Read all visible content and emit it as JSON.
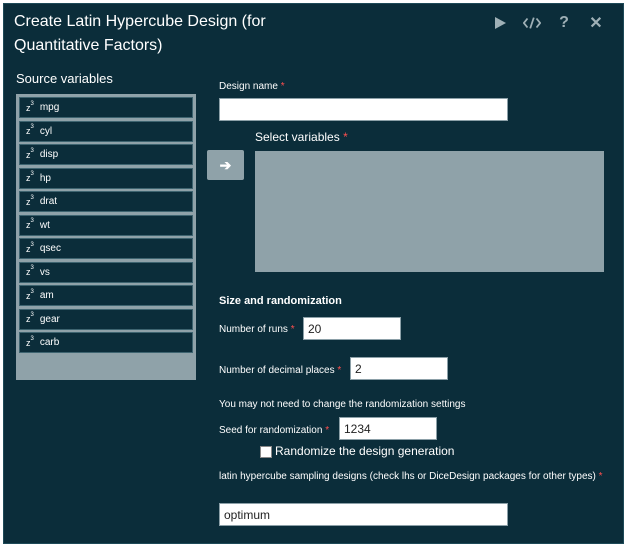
{
  "window": {
    "title": "Create Latin Hypercube Design (for Quantitative Factors)",
    "icons": [
      "run-icon",
      "code-icon",
      "help-icon",
      "close-icon"
    ]
  },
  "source": {
    "label": "Source variables",
    "items": [
      {
        "icon_text": "z",
        "label": "mpg"
      },
      {
        "icon_text": "z",
        "label": "cyl"
      },
      {
        "icon_text": "z",
        "label": "disp"
      },
      {
        "icon_text": "z",
        "label": "hp"
      },
      {
        "icon_text": "z",
        "label": "drat"
      },
      {
        "icon_text": "z",
        "label": "wt"
      },
      {
        "icon_text": "z",
        "label": "qsec"
      },
      {
        "icon_text": "z",
        "label": "vs"
      },
      {
        "icon_text": "z",
        "label": "am"
      },
      {
        "icon_text": "z",
        "label": "gear"
      },
      {
        "icon_text": "z",
        "label": "carb"
      }
    ]
  },
  "form": {
    "design_name_label": "Design name",
    "design_name_value": "",
    "select_variables_label": "Select variables",
    "arrow_glyph": "➔",
    "size_section": "Size and randomization",
    "runs_label": "Number of runs",
    "runs_value": "20",
    "decimals_label": "Number of decimal places",
    "decimals_value": "2",
    "randomization_note": "You may not need to change the randomization settings",
    "seed_label": "Seed for randomization",
    "seed_value": "1234",
    "randomize_label": "Randomize the design generation",
    "randomize_checked": false,
    "lhs_label": "latin hypercube sampling designs (check lhs or DiceDesign packages for other types)",
    "lhs_value": "optimum",
    "required_mark": "*"
  },
  "colors": {
    "panel_bg": "#0b2d3a",
    "list_bg": "#8fa2a9",
    "required": "#ff4f4f"
  }
}
